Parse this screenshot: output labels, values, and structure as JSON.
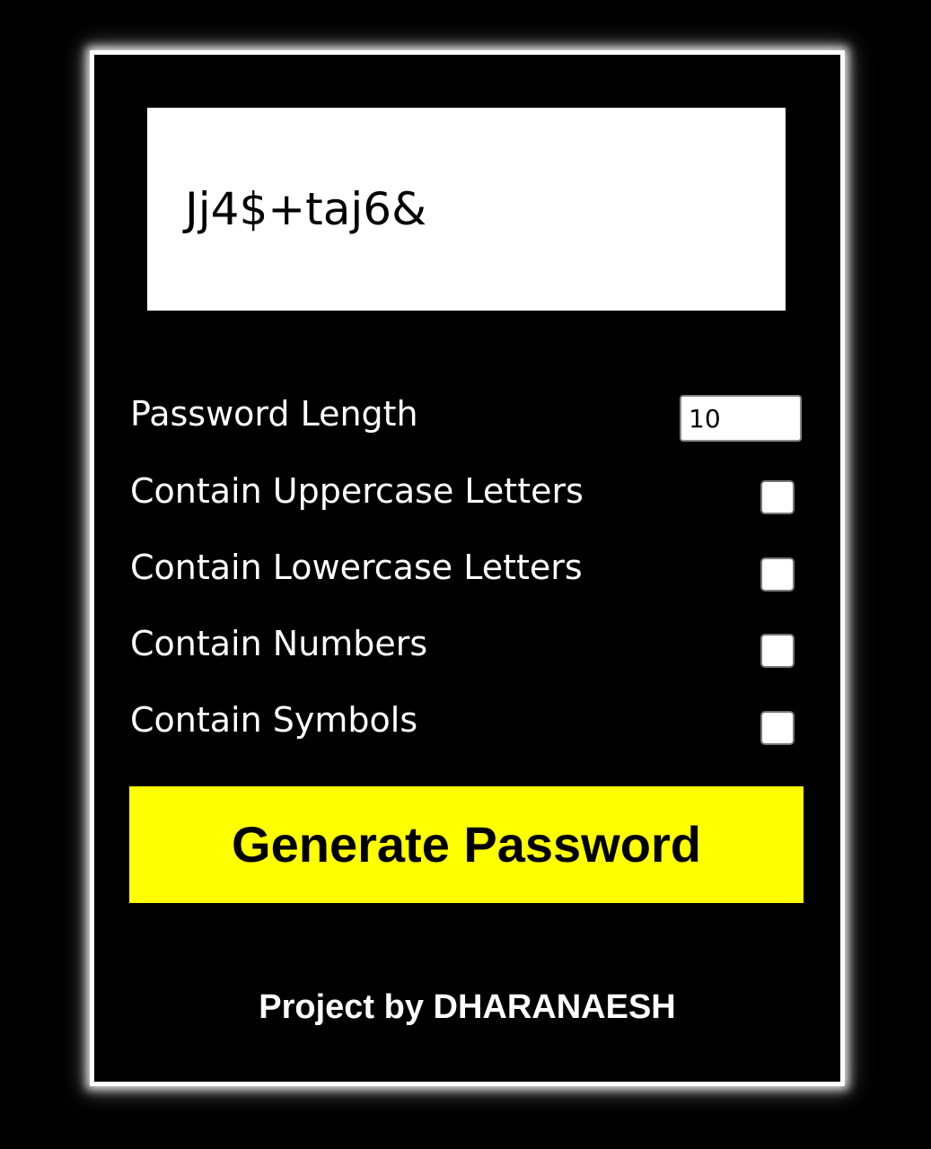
{
  "result": {
    "password": "Jj4$+taj6&"
  },
  "settings": {
    "length": {
      "label": "Password Length",
      "value": "10"
    },
    "uppercase": {
      "label": "Contain Uppercase Letters",
      "checked": false
    },
    "lowercase": {
      "label": "Contain Lowercase Letters",
      "checked": false
    },
    "numbers": {
      "label": "Contain Numbers",
      "checked": false
    },
    "symbols": {
      "label": "Contain Symbols",
      "checked": false
    }
  },
  "generate_button": {
    "label": "Generate Password"
  },
  "footer": {
    "text": "Project by DHARANAESH"
  },
  "colors": {
    "background": "#000000",
    "panel_border": "#ffffff",
    "button": "#ffff00",
    "text": "#ffffff"
  }
}
